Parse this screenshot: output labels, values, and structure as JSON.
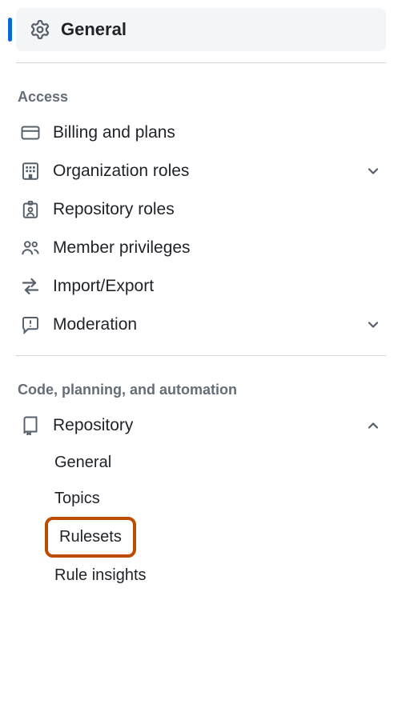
{
  "top_item": {
    "label": "General"
  },
  "sections": {
    "access": {
      "title": "Access",
      "items": {
        "billing": "Billing and plans",
        "org_roles": "Organization roles",
        "repo_roles": "Repository roles",
        "member_priv": "Member privileges",
        "import_export": "Import/Export",
        "moderation": "Moderation"
      }
    },
    "code": {
      "title": "Code, planning, and automation",
      "items": {
        "repository": "Repository",
        "sub": {
          "general": "General",
          "topics": "Topics",
          "rulesets": "Rulesets",
          "rule_insights": "Rule insights"
        }
      }
    }
  }
}
